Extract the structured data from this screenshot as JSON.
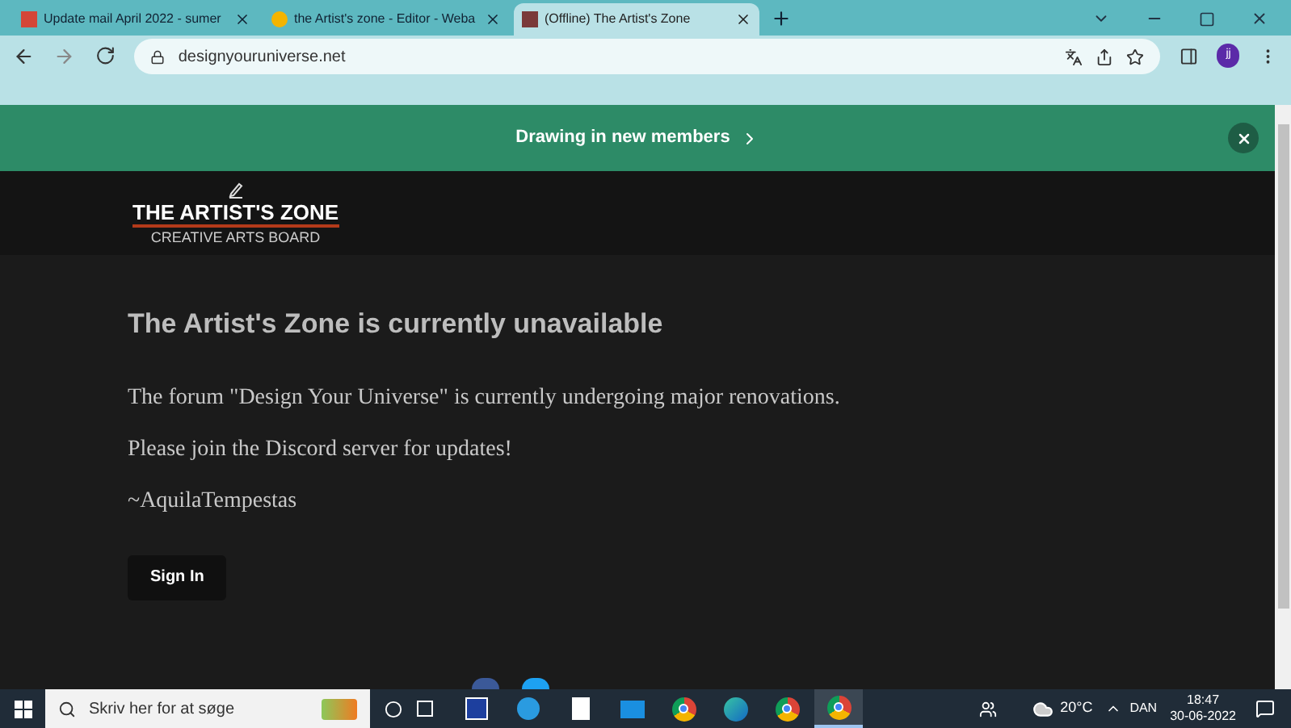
{
  "browser": {
    "tabs": [
      {
        "title": "Update mail April 2022 - sumer",
        "selected": false
      },
      {
        "title": "the Artist's zone - Editor - Weba",
        "selected": false
      },
      {
        "title": "(Offline) The Artist's Zone",
        "selected": true
      }
    ],
    "address": "designyouruniverse.net",
    "profile_initial": "jj"
  },
  "banner": {
    "text": "Drawing in new members"
  },
  "logo": {
    "title": "THE ARTIST'S ZONE",
    "subtitle": "CREATIVE ARTS BOARD"
  },
  "content": {
    "heading": "The Artist's Zone is currently unavailable",
    "paragraphs": [
      "The forum \"Design Your Universe\" is currently undergoing major renovations.",
      "Please join the Discord server for updates!",
      "~AquilaTempestas"
    ],
    "button": "Sign In"
  },
  "taskbar": {
    "search_placeholder": "Skriv her for at søge",
    "apps": [
      {
        "kind": "word",
        "active": false
      },
      {
        "kind": "cloud",
        "active": false
      },
      {
        "kind": "file",
        "active": false
      },
      {
        "kind": "mail",
        "active": false
      },
      {
        "kind": "chrome",
        "active": false
      },
      {
        "kind": "edge",
        "active": false
      },
      {
        "kind": "chrome",
        "active": false
      },
      {
        "kind": "chrome",
        "active": true
      }
    ],
    "weather": "20°C",
    "language": "DAN",
    "time": "18:47",
    "date": "30-06-2022"
  }
}
